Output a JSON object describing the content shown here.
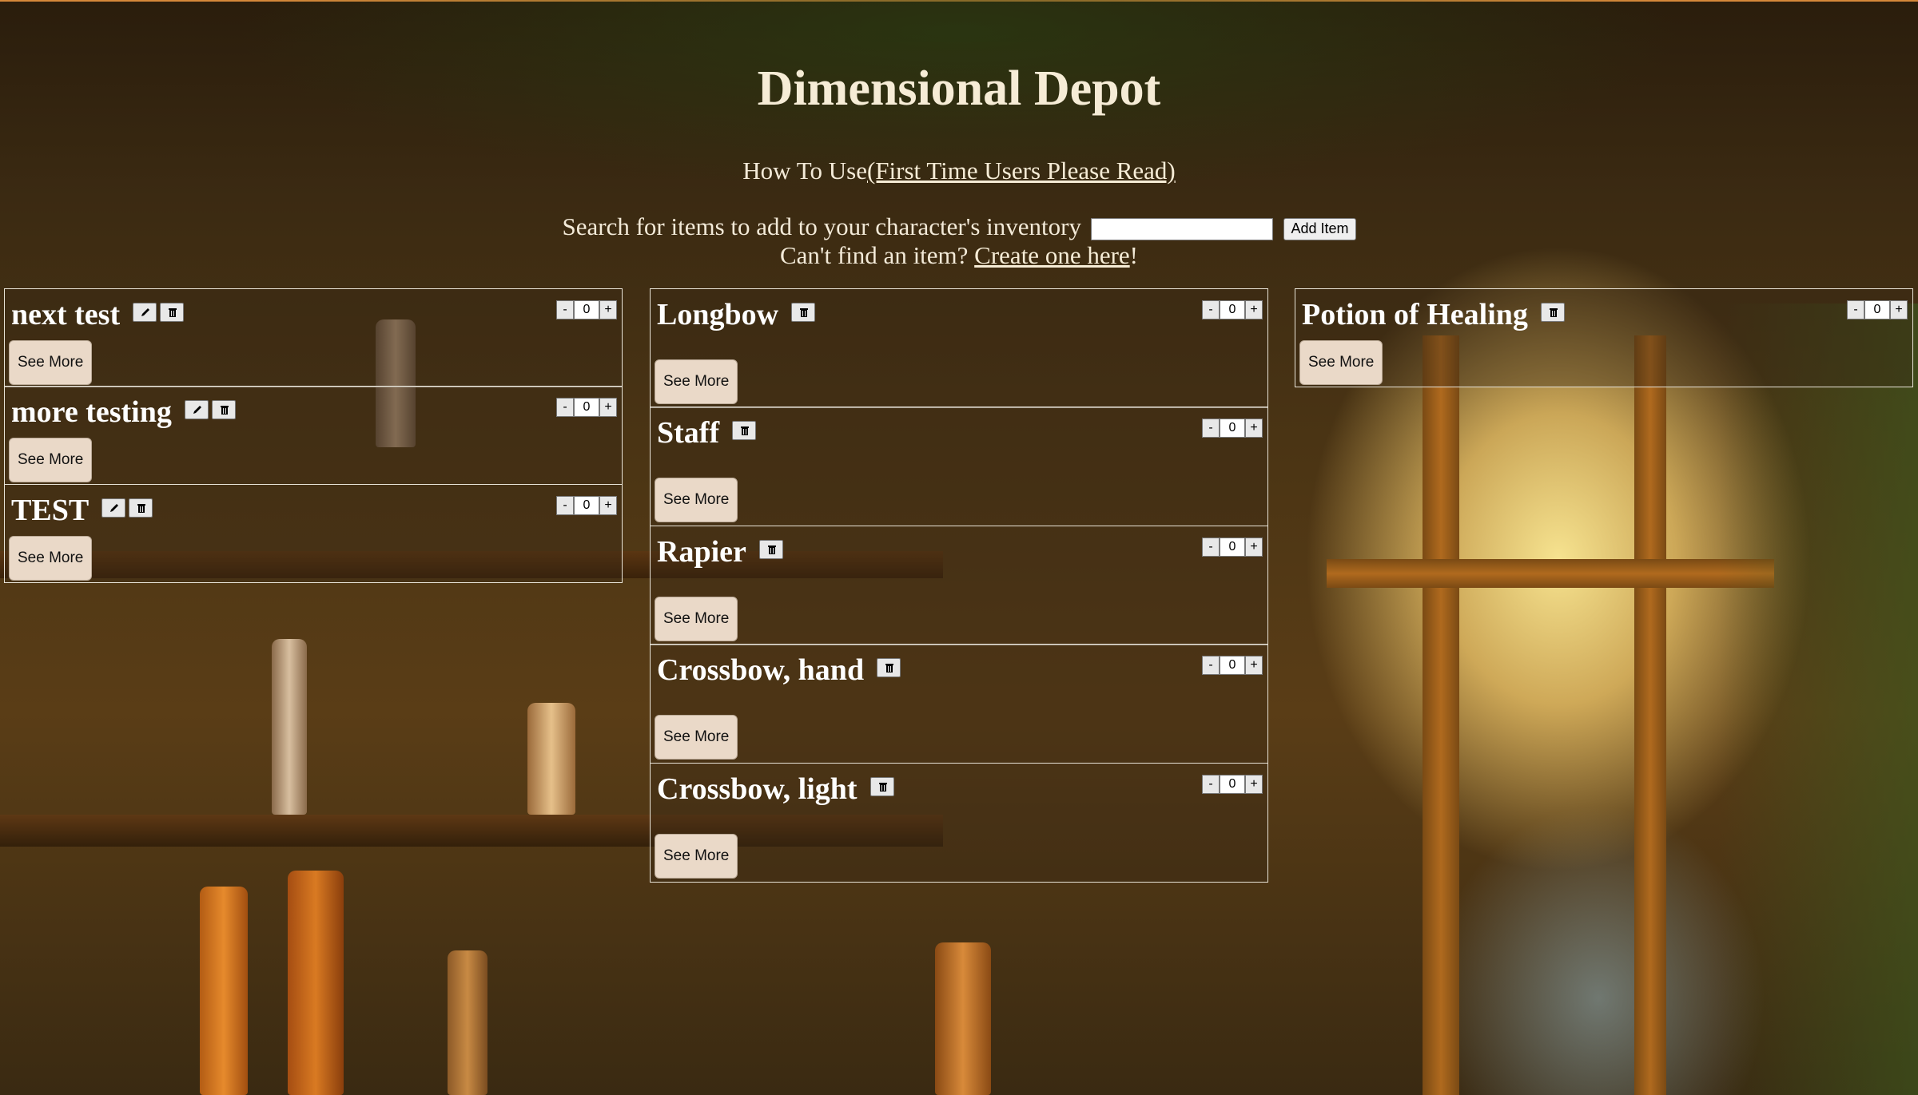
{
  "header": {
    "title": "Dimensional Depot",
    "howto_prefix": "How To Use",
    "howto_link": "(First Time Users Please Read)",
    "search_label": "Search for items to add to your character's inventory",
    "search_value": "",
    "add_button": "Add Item",
    "cant_find_prefix": "Can't find an item? ",
    "cant_find_link": "Create one here",
    "cant_find_suffix": "!"
  },
  "controls": {
    "minus": "-",
    "plus": "+",
    "see_more": "See More"
  },
  "columns": [
    {
      "items": [
        {
          "name": "next test",
          "qty": "0",
          "editable": true
        },
        {
          "name": "more testing",
          "qty": "0",
          "editable": true
        },
        {
          "name": "TEST",
          "qty": "0",
          "editable": true
        }
      ]
    },
    {
      "items": [
        {
          "name": "Longbow",
          "qty": "0",
          "editable": false
        },
        {
          "name": "Staff",
          "qty": "0",
          "editable": false
        },
        {
          "name": "Rapier",
          "qty": "0",
          "editable": false
        },
        {
          "name": "Crossbow, hand",
          "qty": "0",
          "editable": false
        },
        {
          "name": "Crossbow, light",
          "qty": "0",
          "editable": false
        }
      ]
    },
    {
      "items": [
        {
          "name": "Potion of Healing",
          "qty": "0",
          "editable": false
        }
      ]
    }
  ],
  "icons": {
    "edit": "pencil-icon",
    "delete": "trash-icon"
  },
  "colors": {
    "accent_border": "#d6883a",
    "button_bg": "#ead9c8",
    "text": "#f6ecd6"
  }
}
